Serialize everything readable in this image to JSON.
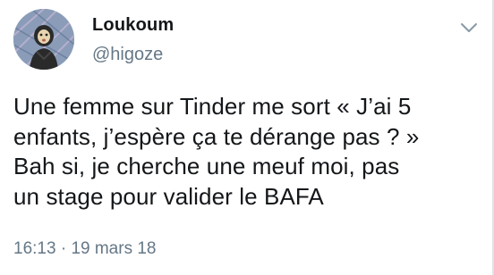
{
  "author": {
    "display_name": "Loukoum",
    "handle": "@higoze",
    "avatar_icon": "avatar-image"
  },
  "tweet": {
    "text": "Une femme sur Tinder me sort « J’ai 5\nenfants, j’espère ça te dérange pas ? »\nBah si, je cherche une meuf moi, pas\nun stage pour valider le BAFA",
    "time": "16:13",
    "separator": "·",
    "date": "19 mars 18"
  },
  "menu": {
    "icon": "chevron-down-icon"
  },
  "colors": {
    "text": "#14171a",
    "secondary": "#657786",
    "background": "#ffffff"
  }
}
